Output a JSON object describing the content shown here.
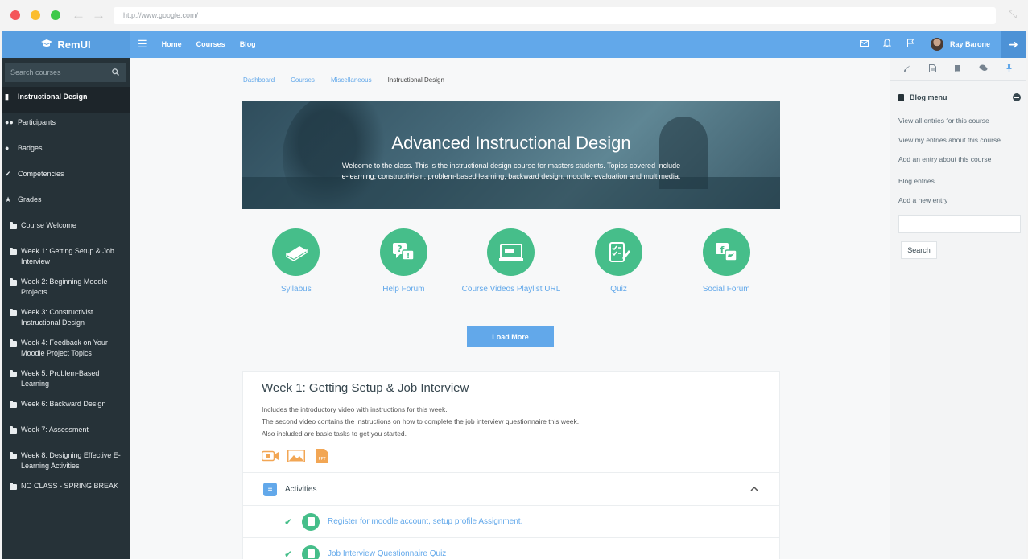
{
  "browser": {
    "url": "http://www.google.com/"
  },
  "brand": {
    "name": "RemUI"
  },
  "topnav": {
    "items": [
      "Home",
      "Courses",
      "Blog"
    ]
  },
  "user": {
    "name": "Ray Barone"
  },
  "sidebar": {
    "search_placeholder": "Search courses",
    "items": [
      {
        "label": "Instructional Design",
        "icon": "book-icon",
        "active": true
      },
      {
        "label": "Participants",
        "icon": "users-icon"
      },
      {
        "label": "Badges",
        "icon": "badge-icon"
      },
      {
        "label": "Competencies",
        "icon": "check-circle-icon"
      },
      {
        "label": "Grades",
        "icon": "star-icon"
      },
      {
        "label": "Course Welcome",
        "icon": "folder-icon"
      },
      {
        "label": "Week 1: Getting Setup & Job Interview",
        "icon": "folder-icon"
      },
      {
        "label": "Week 2: Beginning Moodle Projects",
        "icon": "folder-icon"
      },
      {
        "label": "Week 3: Constructivist Instructional Design",
        "icon": "folder-icon"
      },
      {
        "label": "Week 4: Feedback on Your Moodle Project Topics",
        "icon": "folder-icon"
      },
      {
        "label": "Week 5: Problem-Based Learning",
        "icon": "folder-icon"
      },
      {
        "label": "Week 6: Backward Design",
        "icon": "folder-icon"
      },
      {
        "label": "Week 7: Assessment",
        "icon": "folder-icon"
      },
      {
        "label": "Week 8: Designing Effective E-Learning Activities",
        "icon": "folder-icon"
      },
      {
        "label": "NO CLASS - SPRING BREAK",
        "icon": "folder-icon"
      }
    ]
  },
  "breadcrumb": {
    "items": [
      "Dashboard",
      "Courses",
      "Miscellaneous"
    ],
    "current": "Instructional Design"
  },
  "hero": {
    "title": "Advanced Instructional Design",
    "text": "Welcome to the class. This is the instructional design course for masters students. Topics covered include e-learning, constructivism, problem-based learning, backward design, moodle, evaluation and multimedia."
  },
  "quick_links": [
    {
      "label": "Syllabus",
      "icon": "book-icon"
    },
    {
      "label": "Help Forum",
      "icon": "help-chat-icon"
    },
    {
      "label": "Course Videos Playlist URL",
      "icon": "video-screen-icon"
    },
    {
      "label": "Quiz",
      "icon": "checklist-icon"
    },
    {
      "label": "Social Forum",
      "icon": "social-icon"
    }
  ],
  "load_more": "Load More",
  "section": {
    "title": "Week 1: Getting Setup & Job Interview",
    "lines": [
      "Includes the introductory video with instructions for this week.",
      "The second video contains the instructions on how to complete the job interview questionnaire this week.",
      "Also included are basic tasks to get you started."
    ],
    "activities_title": "Activities",
    "activities": [
      "Register for moodle account, setup profile Assignment.",
      "Job Interview Questionnaire Quiz"
    ]
  },
  "right_sidebar": {
    "block_title": "Blog menu",
    "links": [
      "View all entries for this course",
      "View my entries about this course",
      "Add an entry about this course",
      "Blog entries",
      "Add a new entry"
    ],
    "search_button": "Search"
  },
  "colors": {
    "primary": "#62a8ea",
    "green": "#46be8a",
    "dark": "#263238",
    "orange": "#f2a654"
  }
}
